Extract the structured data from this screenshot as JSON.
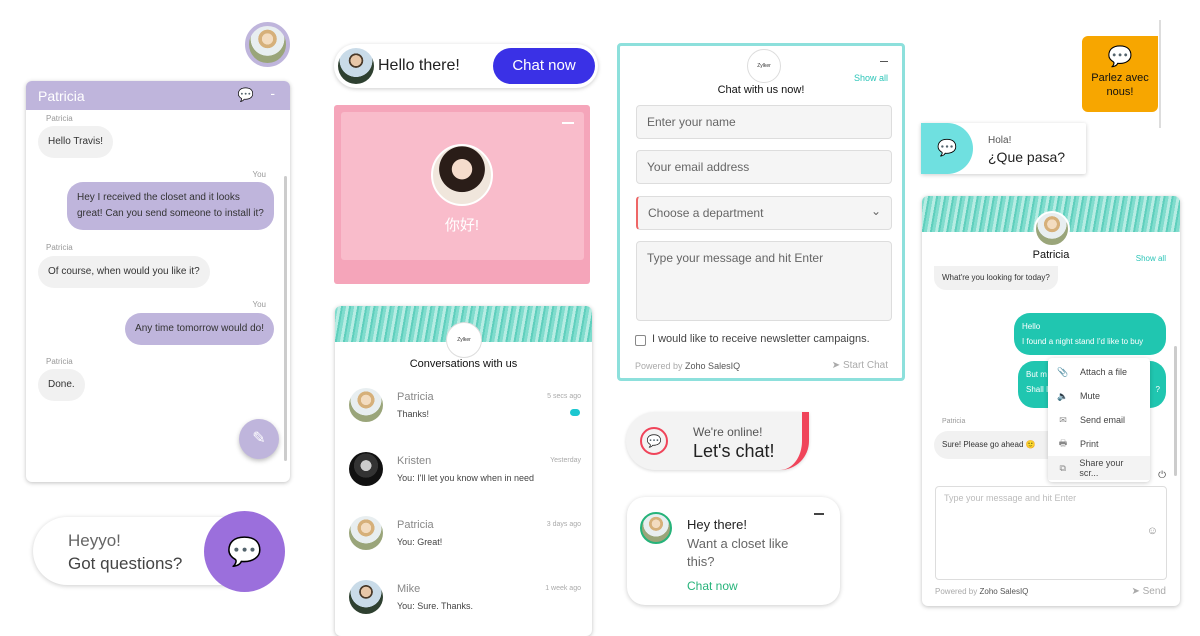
{
  "w1": {
    "agent": "Patricia",
    "you": "You",
    "messages": [
      {
        "from": "Patricia",
        "text": "Hello Travis!"
      },
      {
        "from": "You",
        "text": "Hey I received the closet and it looks great! Can you send someone to install it?"
      },
      {
        "from": "Patricia",
        "text": "Of course, when would you like it?"
      },
      {
        "from": "You",
        "text": "Any time tomorrow would do!"
      },
      {
        "from": "Patricia",
        "text": "Done."
      }
    ],
    "minimize": "-",
    "color": "#bfb5dc"
  },
  "w2": {
    "line1": "Heyyo!",
    "line2": "Got questions?",
    "color": "#9b6fdc"
  },
  "w3": {
    "text": "Hello there!",
    "button": "Chat now",
    "color": "#3a31e6"
  },
  "w4": {
    "text": "你好!",
    "color": "#f7aec0"
  },
  "w5": {
    "logo": "Zylker",
    "title": "Conversations with us",
    "items": [
      {
        "name": "Patricia",
        "time": "5 secs ago",
        "msg": "Thanks!"
      },
      {
        "name": "Kristen",
        "time": "Yesterday",
        "msg": "You: I'll let you know when in need"
      },
      {
        "name": "Patricia",
        "time": "3 days ago",
        "msg": "You: Great!"
      },
      {
        "name": "Mike",
        "time": "1 week ago",
        "msg": "You: Sure. Thanks."
      }
    ]
  },
  "w6": {
    "logo": "Zylker",
    "show_all": "Show all",
    "title": "Chat with us now!",
    "name_ph": "Enter your name",
    "email_ph": "Your email address",
    "dept": "Choose a department",
    "msg_ph": "Type your message and hit Enter",
    "newsletter": "I would like to receive newsletter campaigns.",
    "powered": "Powered by",
    "brand": "Zoho SalesIQ",
    "start": "Start Chat",
    "color": "#8de0dc"
  },
  "w7": {
    "line1": "We're online!",
    "line2": "Let's chat!",
    "color": "#f0445a"
  },
  "w8": {
    "title": "Hey there!",
    "text": "Want a closet like this?",
    "cta": "Chat now",
    "color": "#26b37a"
  },
  "w9": {
    "text": "Parlez avec nous!",
    "color": "#f7a600"
  },
  "w10": {
    "line1": "Hola!",
    "line2": "¿Que pasa?",
    "color": "#6fe0e0"
  },
  "w11": {
    "agent": "Patricia",
    "show_all": "Show all",
    "m1": "What're you looking for today?",
    "m2a": "Hello",
    "m2b": "I found a night stand I'd like to buy",
    "m3a": "But m",
    "m3b": "Shall I",
    "m3c": "?",
    "m4": "Sure! Please go ahead",
    "menu": [
      "Attach a file",
      "Mute",
      "Send email",
      "Print",
      "Share your scr..."
    ],
    "input_ph": "Type your message and hit Enter",
    "powered": "Powered by",
    "brand": "Zoho SalesIQ",
    "send": "Send",
    "color": "#20c6b0"
  }
}
